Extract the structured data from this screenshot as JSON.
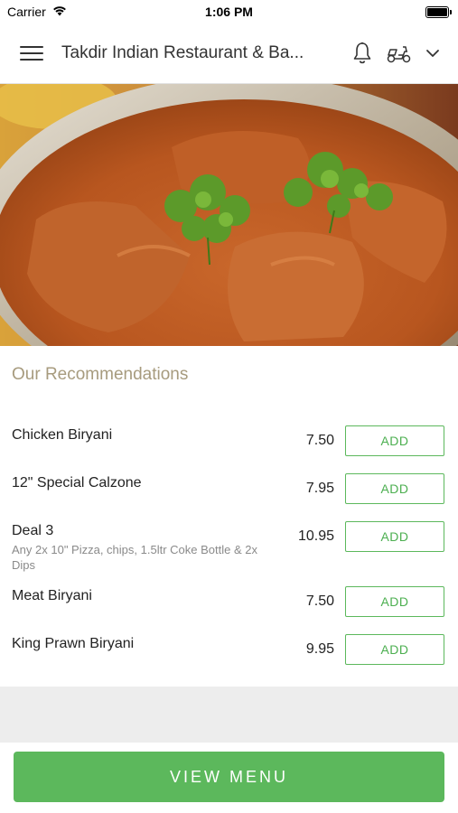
{
  "status": {
    "carrier": "Carrier",
    "time": "1:06 PM"
  },
  "header": {
    "title": "Takdir Indian Restaurant & Ba..."
  },
  "recommendations": {
    "title": "Our Recommendations",
    "items": [
      {
        "name": "Chicken Biryani",
        "price": "7.50",
        "action": "ADD"
      },
      {
        "name": "12\" Special Calzone",
        "price": "7.95",
        "action": "ADD"
      },
      {
        "name": "Deal 3",
        "description": "Any 2x 10\" Pizza, chips, 1.5ltr Coke Bottle & 2x Dips",
        "price": "10.95",
        "action": "ADD"
      },
      {
        "name": "Meat Biryani",
        "price": "7.50",
        "action": "ADD"
      },
      {
        "name": "King Prawn Biryani",
        "price": "9.95",
        "action": "ADD"
      }
    ]
  },
  "footer": {
    "view_menu_label": "VIEW MENU"
  },
  "colors": {
    "accent_green": "#5cb85c",
    "section_title": "#a79b7e"
  }
}
